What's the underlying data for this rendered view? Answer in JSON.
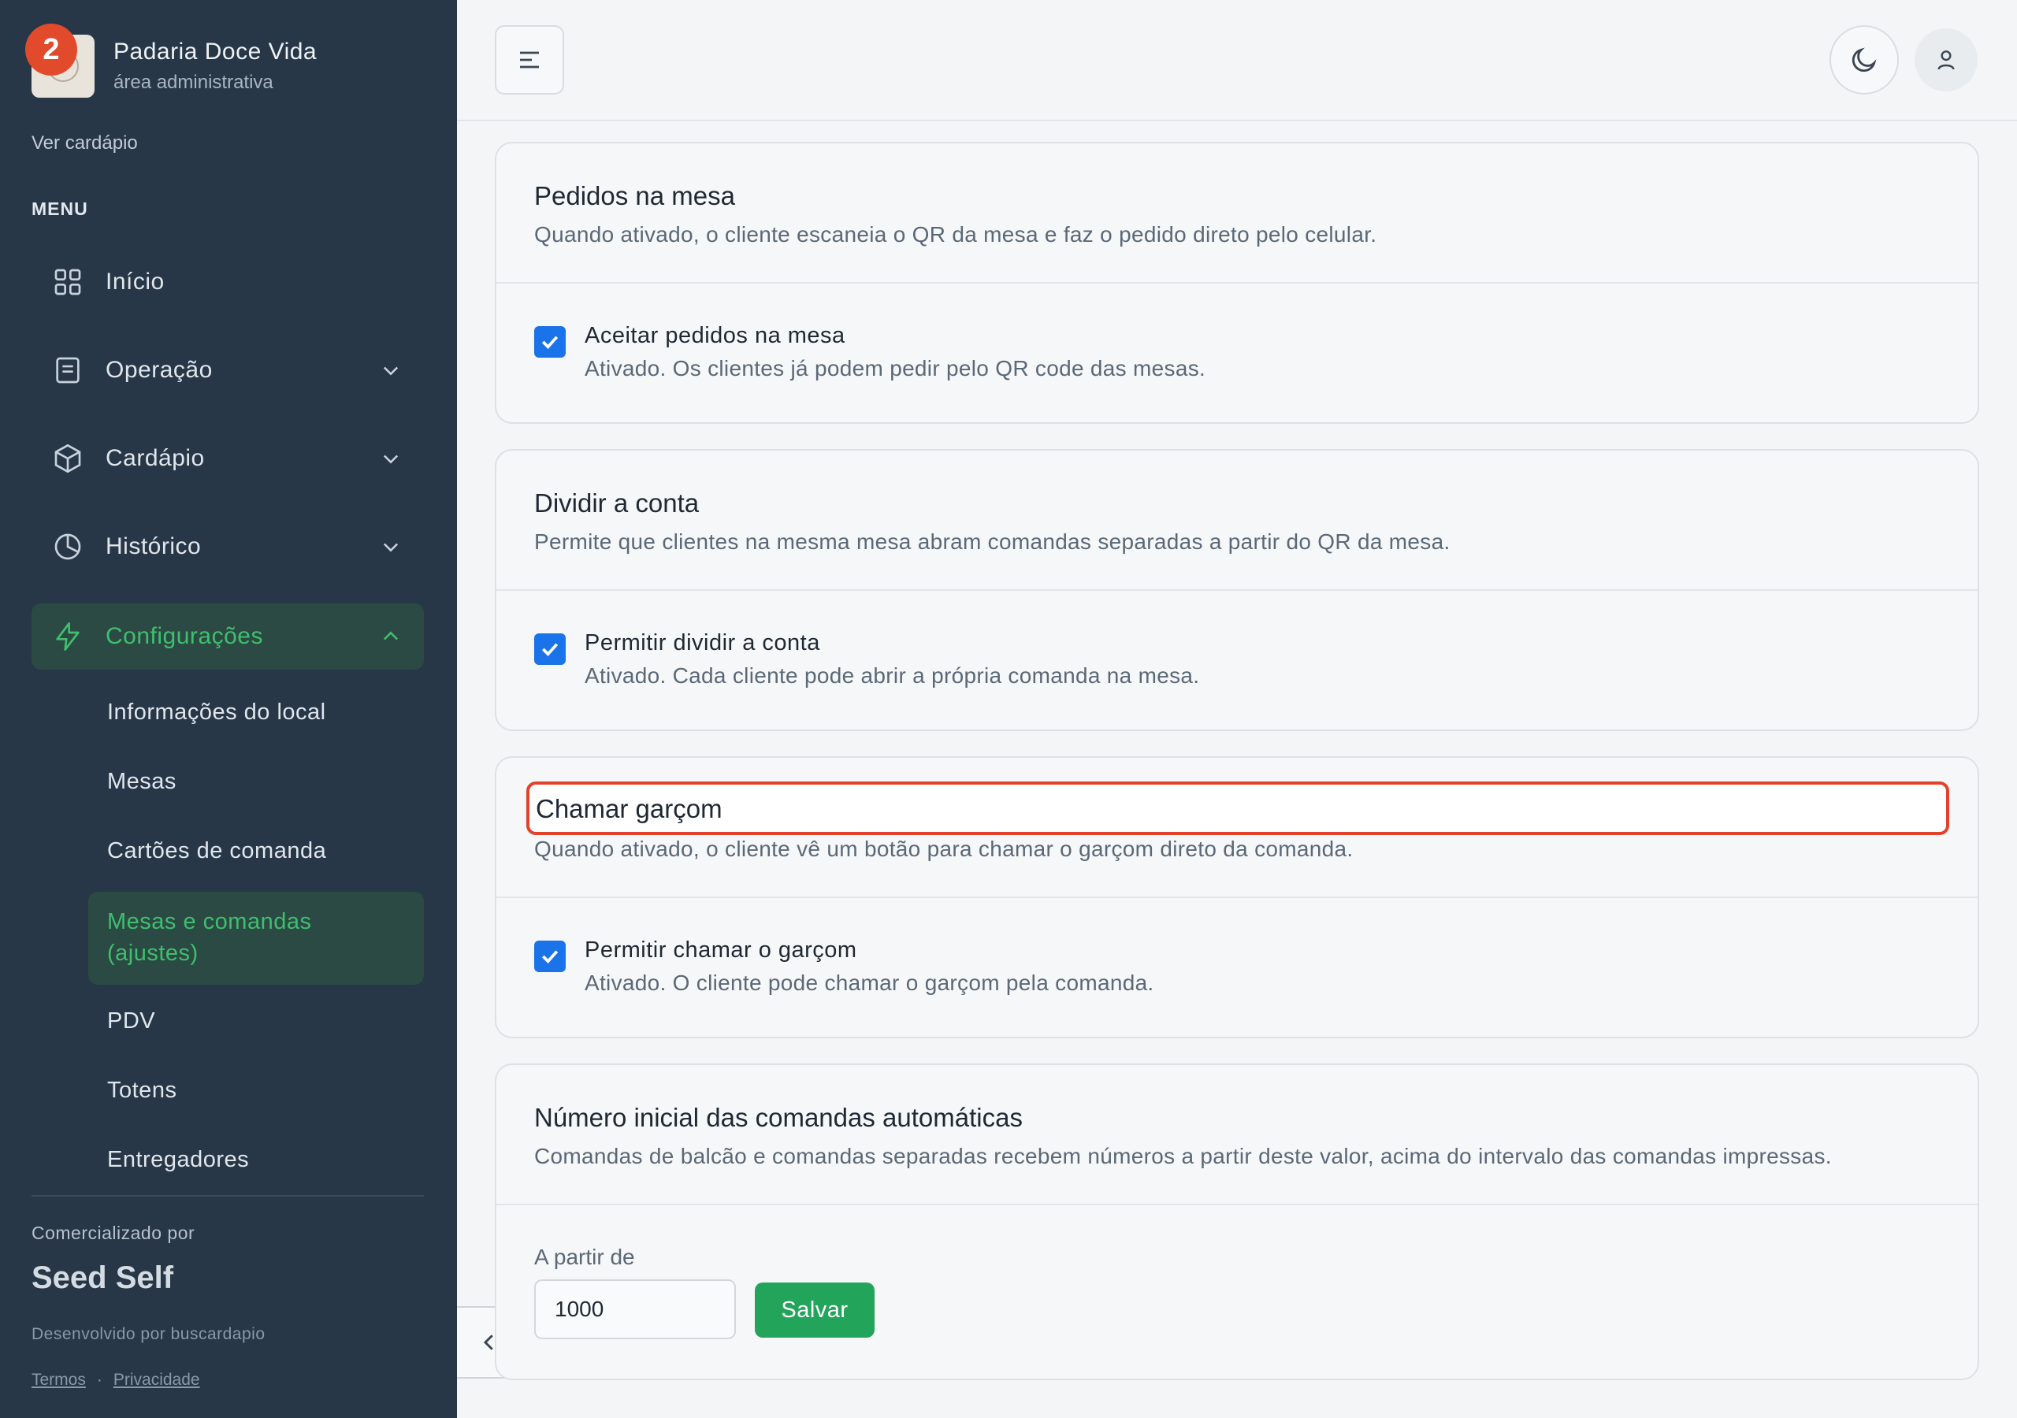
{
  "sidebar": {
    "badge_count": "2",
    "brand_name": "Padaria Doce Vida",
    "brand_sub": "área administrativa",
    "ver_cardapio": "Ver cardápio",
    "menu_label": "MENU",
    "items": [
      {
        "label": "Início",
        "icon": "grid-icon"
      },
      {
        "label": "Operação",
        "icon": "document-icon"
      },
      {
        "label": "Cardápio",
        "icon": "box-icon"
      },
      {
        "label": "Histórico",
        "icon": "pie-chart-icon"
      },
      {
        "label": "Configurações",
        "icon": "bolt-icon"
      }
    ],
    "sub_items": [
      "Informações do local",
      "Mesas",
      "Cartões de comanda",
      "Mesas e comandas (ajustes)",
      "PDV",
      "Totens",
      "Entregadores"
    ],
    "comercializado_por": "Comercializado por",
    "seed_self": "Seed Self",
    "desenvolvido_por": "Desenvolvido por buscardapio",
    "termos": "Termos",
    "separator": "·",
    "privacidade": "Privacidade"
  },
  "cards": {
    "pedidos": {
      "title": "Pedidos na mesa",
      "desc": "Quando ativado, o cliente escaneia o QR da mesa e faz o pedido direto pelo celular.",
      "checkbox_label": "Aceitar pedidos na mesa",
      "checkbox_desc": "Ativado. Os clientes já podem pedir pelo QR code das mesas."
    },
    "dividir": {
      "title": "Dividir a conta",
      "desc": "Permite que clientes na mesma mesa abram comandas separadas a partir do QR da mesa.",
      "checkbox_label": "Permitir dividir a conta",
      "checkbox_desc": "Ativado. Cada cliente pode abrir a própria comanda na mesa."
    },
    "garcom": {
      "title": "Chamar garçom",
      "desc": "Quando ativado, o cliente vê um botão para chamar o garçom direto da comanda.",
      "checkbox_label": "Permitir chamar o garçom",
      "checkbox_desc": "Ativado. O cliente pode chamar o garçom pela comanda."
    },
    "numero": {
      "title": "Número inicial das comandas automáticas",
      "desc": "Comandas de balcão e comandas separadas recebem números a partir deste valor, acima do intervalo das comandas impressas.",
      "field_label": "A partir de",
      "field_value": "1000",
      "save_label": "Salvar"
    }
  },
  "colors": {
    "sidebar_bg": "#273747",
    "accent_green": "#3fbf6e",
    "checkbox_blue": "#1a73e8",
    "highlight_red": "#e2422b",
    "save_green": "#22a55a"
  }
}
